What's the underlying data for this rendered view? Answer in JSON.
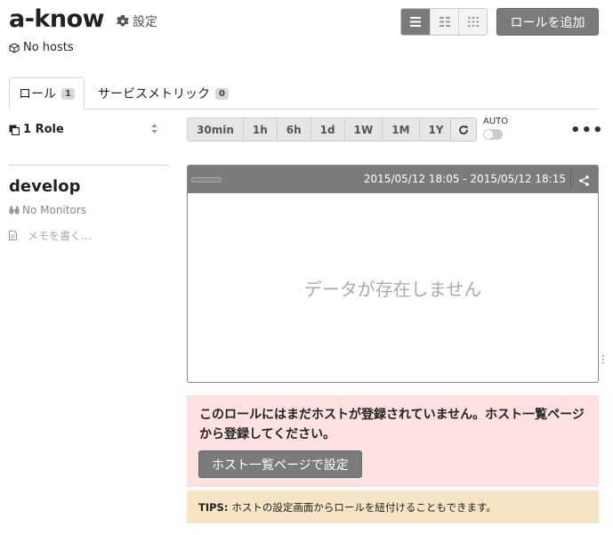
{
  "header": {
    "title": "a-know",
    "settings_label": "設定",
    "hosts_text": "No hosts",
    "add_role_label": "ロールを追加",
    "view_modes": [
      "list-view-icon",
      "card-view-icon",
      "grid-view-icon"
    ]
  },
  "tabs": [
    {
      "label": "ロール",
      "count": "1"
    },
    {
      "label": "サービスメトリック",
      "count": "0"
    }
  ],
  "sidebar": {
    "role_count": "1 Role",
    "role_name": "develop",
    "monitors_text": "No Monitors",
    "memo_placeholder": "メモを書く…"
  },
  "time_ranges": [
    "30min",
    "1h",
    "6h",
    "1d",
    "1W",
    "1M",
    "1Y"
  ],
  "auto_label": "AUTO",
  "auto_enabled": false,
  "more_label": "•••",
  "graph": {
    "period": "2015/05/12 18:05 - 2015/05/12 18:15",
    "empty_message": "データが存在しません"
  },
  "alert": {
    "message": "このロールにはまだホストが登録されていません。ホスト一覧ページから登録してください。",
    "button_label": "ホスト一覧ページで設定"
  },
  "tips": {
    "label": "TIPS:",
    "text": "ホストの設定画面からロールを紐付けることもできます。"
  },
  "colors": {
    "button_gray": "#7b7b7b",
    "alert_bg": "#fde0e0",
    "tips_bg": "#f6e5c4"
  }
}
